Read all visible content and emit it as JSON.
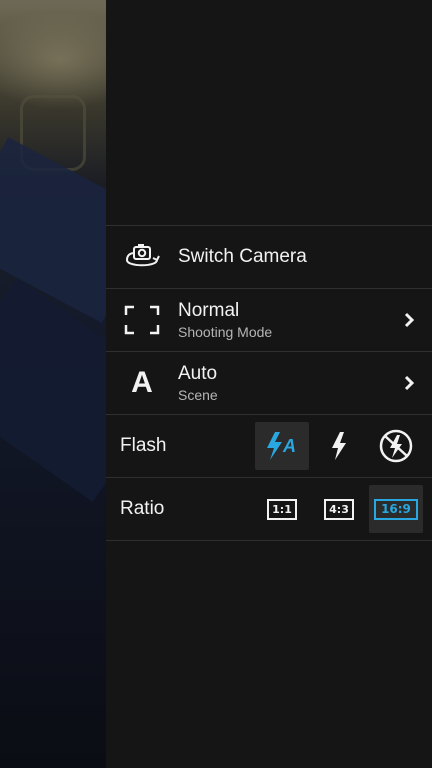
{
  "menu": {
    "switch_camera": {
      "title": "Switch Camera",
      "icon": "switch-camera-icon"
    },
    "shooting_mode": {
      "title": "Normal",
      "subtitle": "Shooting Mode",
      "icon": "frame-corners-icon"
    },
    "scene": {
      "title": "Auto",
      "subtitle": "Scene",
      "icon_text": "A"
    },
    "flash": {
      "label": "Flash",
      "options": [
        {
          "name": "flash-auto",
          "icon": "flash-auto-icon",
          "glyph": "A",
          "selected": true
        },
        {
          "name": "flash-on",
          "icon": "flash-on-icon",
          "selected": false
        },
        {
          "name": "flash-off",
          "icon": "flash-off-icon",
          "selected": false
        }
      ]
    },
    "ratio": {
      "label": "Ratio",
      "options": [
        {
          "label": "1:1",
          "selected": false
        },
        {
          "label": "4:3",
          "selected": false
        },
        {
          "label": "16:9",
          "selected": true
        }
      ]
    }
  },
  "colors": {
    "accent": "#29a7e1",
    "panel_bg": "#151515",
    "divider": "#2f2f2f",
    "text": "#f2f2f2",
    "subtext": "#b5b5b5"
  }
}
